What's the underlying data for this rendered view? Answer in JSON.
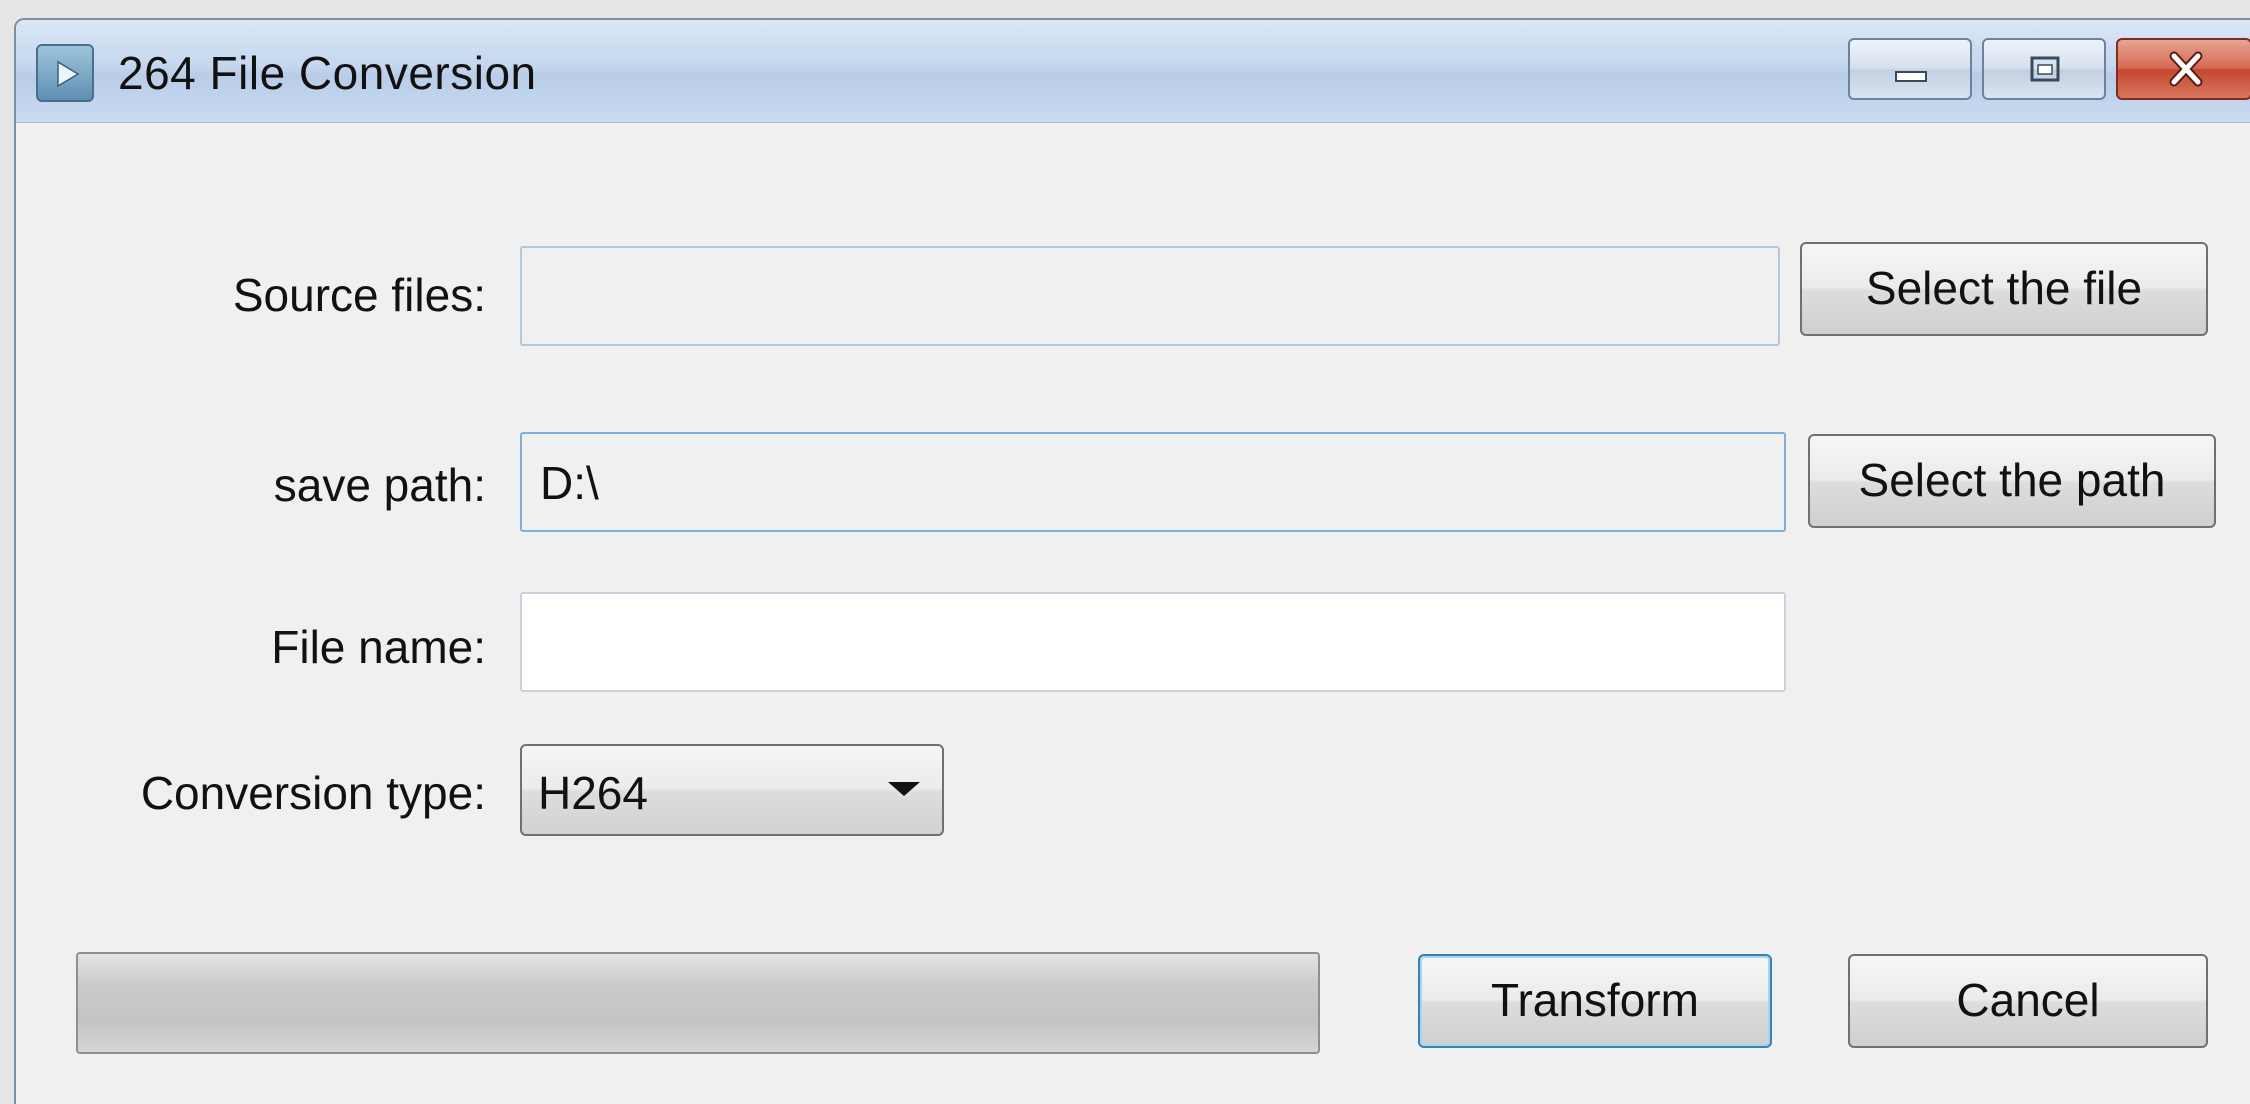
{
  "window": {
    "title": "264 File Conversion",
    "icon": "video-play-icon",
    "controls": {
      "minimize": "minimize-icon",
      "maximize": "maximize-icon",
      "close": "close-icon"
    }
  },
  "form": {
    "source_files": {
      "label": "Source files:",
      "value": "",
      "button_label": "Select the file"
    },
    "save_path": {
      "label": "save path:",
      "value": "D:\\",
      "button_label": "Select the path"
    },
    "file_name": {
      "label": "File name:",
      "value": ""
    },
    "conversion_type": {
      "label": "Conversion type:",
      "selected": "H264"
    }
  },
  "footer": {
    "progress": 0,
    "transform_label": "Transform",
    "cancel_label": "Cancel"
  },
  "colors": {
    "title_bar": "#c5d7ee",
    "close_button": "#c4472f",
    "default_button_border": "#3c7fb1"
  }
}
